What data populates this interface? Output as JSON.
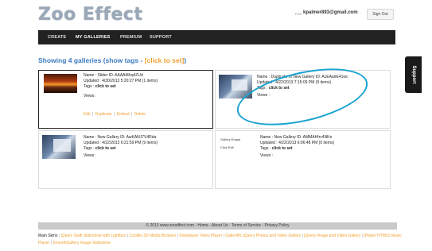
{
  "header": {
    "logo": "Zoo Effect",
    "free_label": "Free",
    "email": "kpalmer893@gmail.com",
    "signout_label": "Sign Out"
  },
  "nav": [
    "CREATE",
    "MY GALLERIES",
    "PREMIUM",
    "SUPPORT"
  ],
  "heading": {
    "main": "Showing 4 galleries (show tags - ",
    "click_set": "[click to set]",
    "close": ")"
  },
  "support_tab": "Support",
  "galleries": [
    {
      "name_line": "Name : Slider ID: AAAAMIrq4ZUd",
      "updated_line": "Updated : 4/30/2013 5:20:27 PM (1 items)",
      "tags_label": "Tags : ",
      "tags_value": "click to set",
      "views_label": "Views :",
      "links": [
        "Edit",
        "Duplicate",
        "Embed",
        "Delete"
      ]
    },
    {
      "name_line": "Name : Duplicate of New Gallery ID: AcEAalrE41wc",
      "updated_line": "Updated : 4/22/2013 7:15:09 PM (9 items)",
      "tags_label": "Tags : ",
      "tags_value": "click to set",
      "views_label": "Views :"
    },
    {
      "name_line": "Name : New Gallery ID: AwKANJ7V4Rda",
      "updated_line": "Updated : 4/22/2013 6:21:59 PM (9 items)",
      "tags_label": "Tags : ",
      "tags_value": "click to set",
      "views_label": "Views :"
    },
    {
      "side_label_1": "Gallery Empty",
      "side_label_2": "Click Edit",
      "name_line": "Name : New Gallery ID: AMMAHIrv4NKe",
      "updated_line": "Updated : 4/22/2013 6:06:48 PM (0 items)",
      "tags_label": "Tags : ",
      "tags_value": "click to set",
      "views_label": "Views :"
    }
  ],
  "footer": {
    "copyright": "© 2013 www.zooeffect.com - Home - About Us - Terms of Service - Privacy Policy",
    "main_skins_label": "Main Skins : ",
    "skins": [
      "jQuery Swift Slideshow with Lightbox",
      "Coolitis 3D Media Browser",
      "Flowplayer Video Player",
      "Galleriffic jQuery Photos and Video Gallery",
      "jQuery Image and Video Gallery",
      "jPlayer HTML5 Music Player",
      "SmoothGallery Image Slideshow"
    ]
  },
  "colors": {
    "accent_blue": "#3b7bc0",
    "link_orange": "#f0a030",
    "annotation_cyan": "#1aa3d1",
    "nav_bg": "#222222"
  }
}
